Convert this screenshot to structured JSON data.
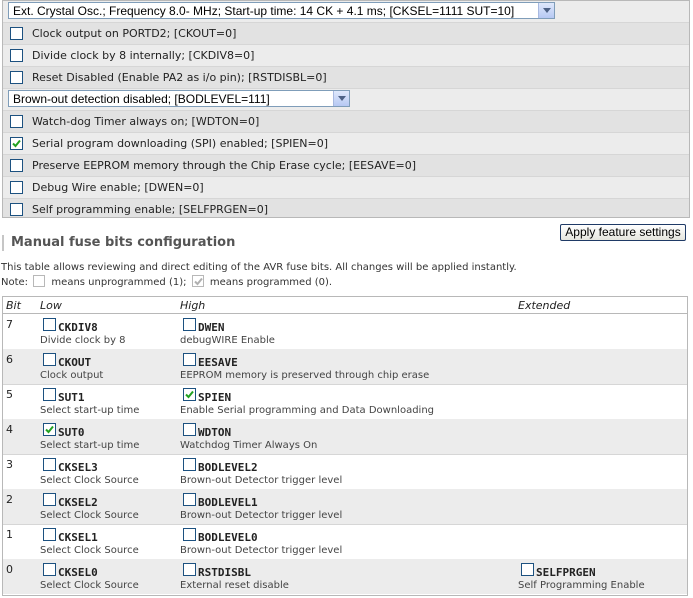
{
  "features": {
    "clock_select": "Ext. Crystal Osc.; Frequency 8.0- MHz; Start-up time: 14 CK + 4.1 ms; [CKSEL=1111 SUT=10]",
    "ckout": {
      "label": "Clock output on PORTD2; [CKOUT=0]",
      "checked": false
    },
    "ckdiv8": {
      "label": "Divide clock by 8 internally; [CKDIV8=0]",
      "checked": false
    },
    "rstdisbl": {
      "label": "Reset Disabled (Enable PA2 as i/o pin); [RSTDISBL=0]",
      "checked": false
    },
    "bodlevel_select": "Brown-out detection disabled; [BODLEVEL=111]",
    "wdton": {
      "label": "Watch-dog Timer always on; [WDTON=0]",
      "checked": false
    },
    "spien": {
      "label": "Serial program downloading (SPI) enabled; [SPIEN=0]",
      "checked": true
    },
    "eesave": {
      "label": "Preserve EEPROM memory through the Chip Erase cycle; [EESAVE=0]",
      "checked": false
    },
    "dwen": {
      "label": "Debug Wire enable; [DWEN=0]",
      "checked": false
    },
    "selfprgen": {
      "label": "Self programming enable; [SELFPRGEN=0]",
      "checked": false
    }
  },
  "apply_button": "Apply feature settings",
  "manual": {
    "title": "Manual fuse bits configuration",
    "intro": "This table allows reviewing and direct editing of the AVR fuse bits. All changes will be applied instantly.",
    "note_prefix": "Note:",
    "note_unprogrammed": "means unprogrammed (1);",
    "note_programmed": "means programmed (0)."
  },
  "table": {
    "headers": {
      "bit": "Bit",
      "low": "Low",
      "high": "High",
      "extended": "Extended"
    },
    "rows": [
      {
        "bit": "7",
        "low": {
          "name": "CKDIV8",
          "desc": "Divide clock by 8",
          "checked": false
        },
        "high": {
          "name": "DWEN",
          "desc": "debugWIRE Enable",
          "checked": false
        }
      },
      {
        "bit": "6",
        "low": {
          "name": "CKOUT",
          "desc": "Clock output",
          "checked": false
        },
        "high": {
          "name": "EESAVE",
          "desc": "EEPROM memory is preserved through chip erase",
          "checked": false
        }
      },
      {
        "bit": "5",
        "low": {
          "name": "SUT1",
          "desc": "Select start-up time",
          "checked": false
        },
        "high": {
          "name": "SPIEN",
          "desc": "Enable Serial programming and Data Downloading",
          "checked": true
        }
      },
      {
        "bit": "4",
        "low": {
          "name": "SUT0",
          "desc": "Select start-up time",
          "checked": true
        },
        "high": {
          "name": "WDTON",
          "desc": "Watchdog Timer Always On",
          "checked": false
        }
      },
      {
        "bit": "3",
        "low": {
          "name": "CKSEL3",
          "desc": "Select Clock Source",
          "checked": false
        },
        "high": {
          "name": "BODLEVEL2",
          "desc": "Brown-out Detector trigger level",
          "checked": false
        }
      },
      {
        "bit": "2",
        "low": {
          "name": "CKSEL2",
          "desc": "Select Clock Source",
          "checked": false
        },
        "high": {
          "name": "BODLEVEL1",
          "desc": "Brown-out Detector trigger level",
          "checked": false
        }
      },
      {
        "bit": "1",
        "low": {
          "name": "CKSEL1",
          "desc": "Select Clock Source",
          "checked": false
        },
        "high": {
          "name": "BODLEVEL0",
          "desc": "Brown-out Detector trigger level",
          "checked": false
        }
      },
      {
        "bit": "0",
        "low": {
          "name": "CKSEL0",
          "desc": "Select Clock Source",
          "checked": false
        },
        "high": {
          "name": "RSTDISBL",
          "desc": "External reset disable",
          "checked": false
        },
        "extended": {
          "name": "SELFPRGEN",
          "desc": "Self Programming Enable",
          "checked": false
        }
      }
    ]
  }
}
